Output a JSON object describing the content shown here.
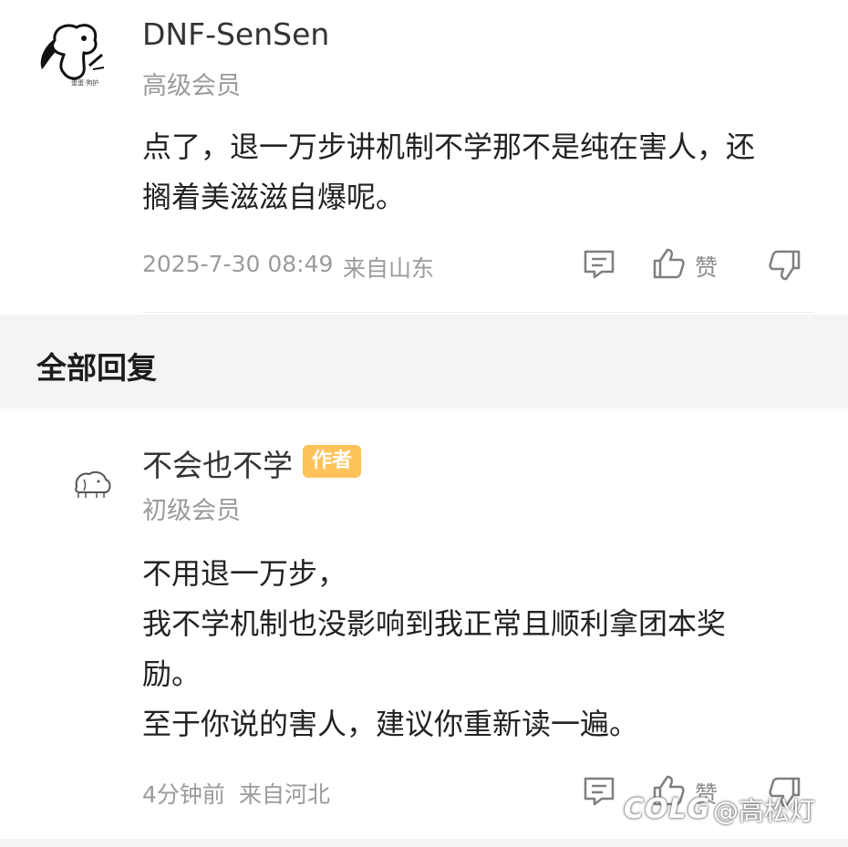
{
  "comment": {
    "username": "DNF-SenSen",
    "level": "高级会员",
    "text": "点了，退一万步讲机制不学那不是纯在害人，还\n搁着美滋滋自爆呢。",
    "time": "2025-7-30 08:49",
    "location": "来自山东",
    "like_label": "赞",
    "avatar_icon": "cartoon-dog-avatar",
    "avatar_small_text": "蛋蛋·狗护"
  },
  "section": {
    "title": "全部回复"
  },
  "reply": {
    "username": "不会也不学",
    "badge": "作者",
    "level": "初级会员",
    "text": "不用退一万步，\n我不学机制也没影响到我正常且顺利拿团本奖\n励。\n至于你说的害人，建议你重新读一遍。",
    "time": "4分钟前",
    "location": "来自河北",
    "like_label": "赞",
    "avatar_icon": "sketch-animal-avatar"
  },
  "watermark": {
    "logo": "COLG",
    "text": "@高松灯"
  },
  "colors": {
    "badge_bg": "#ffc35a",
    "section_bg": "#f4f4f4",
    "meta_text": "#9b9b9b"
  }
}
